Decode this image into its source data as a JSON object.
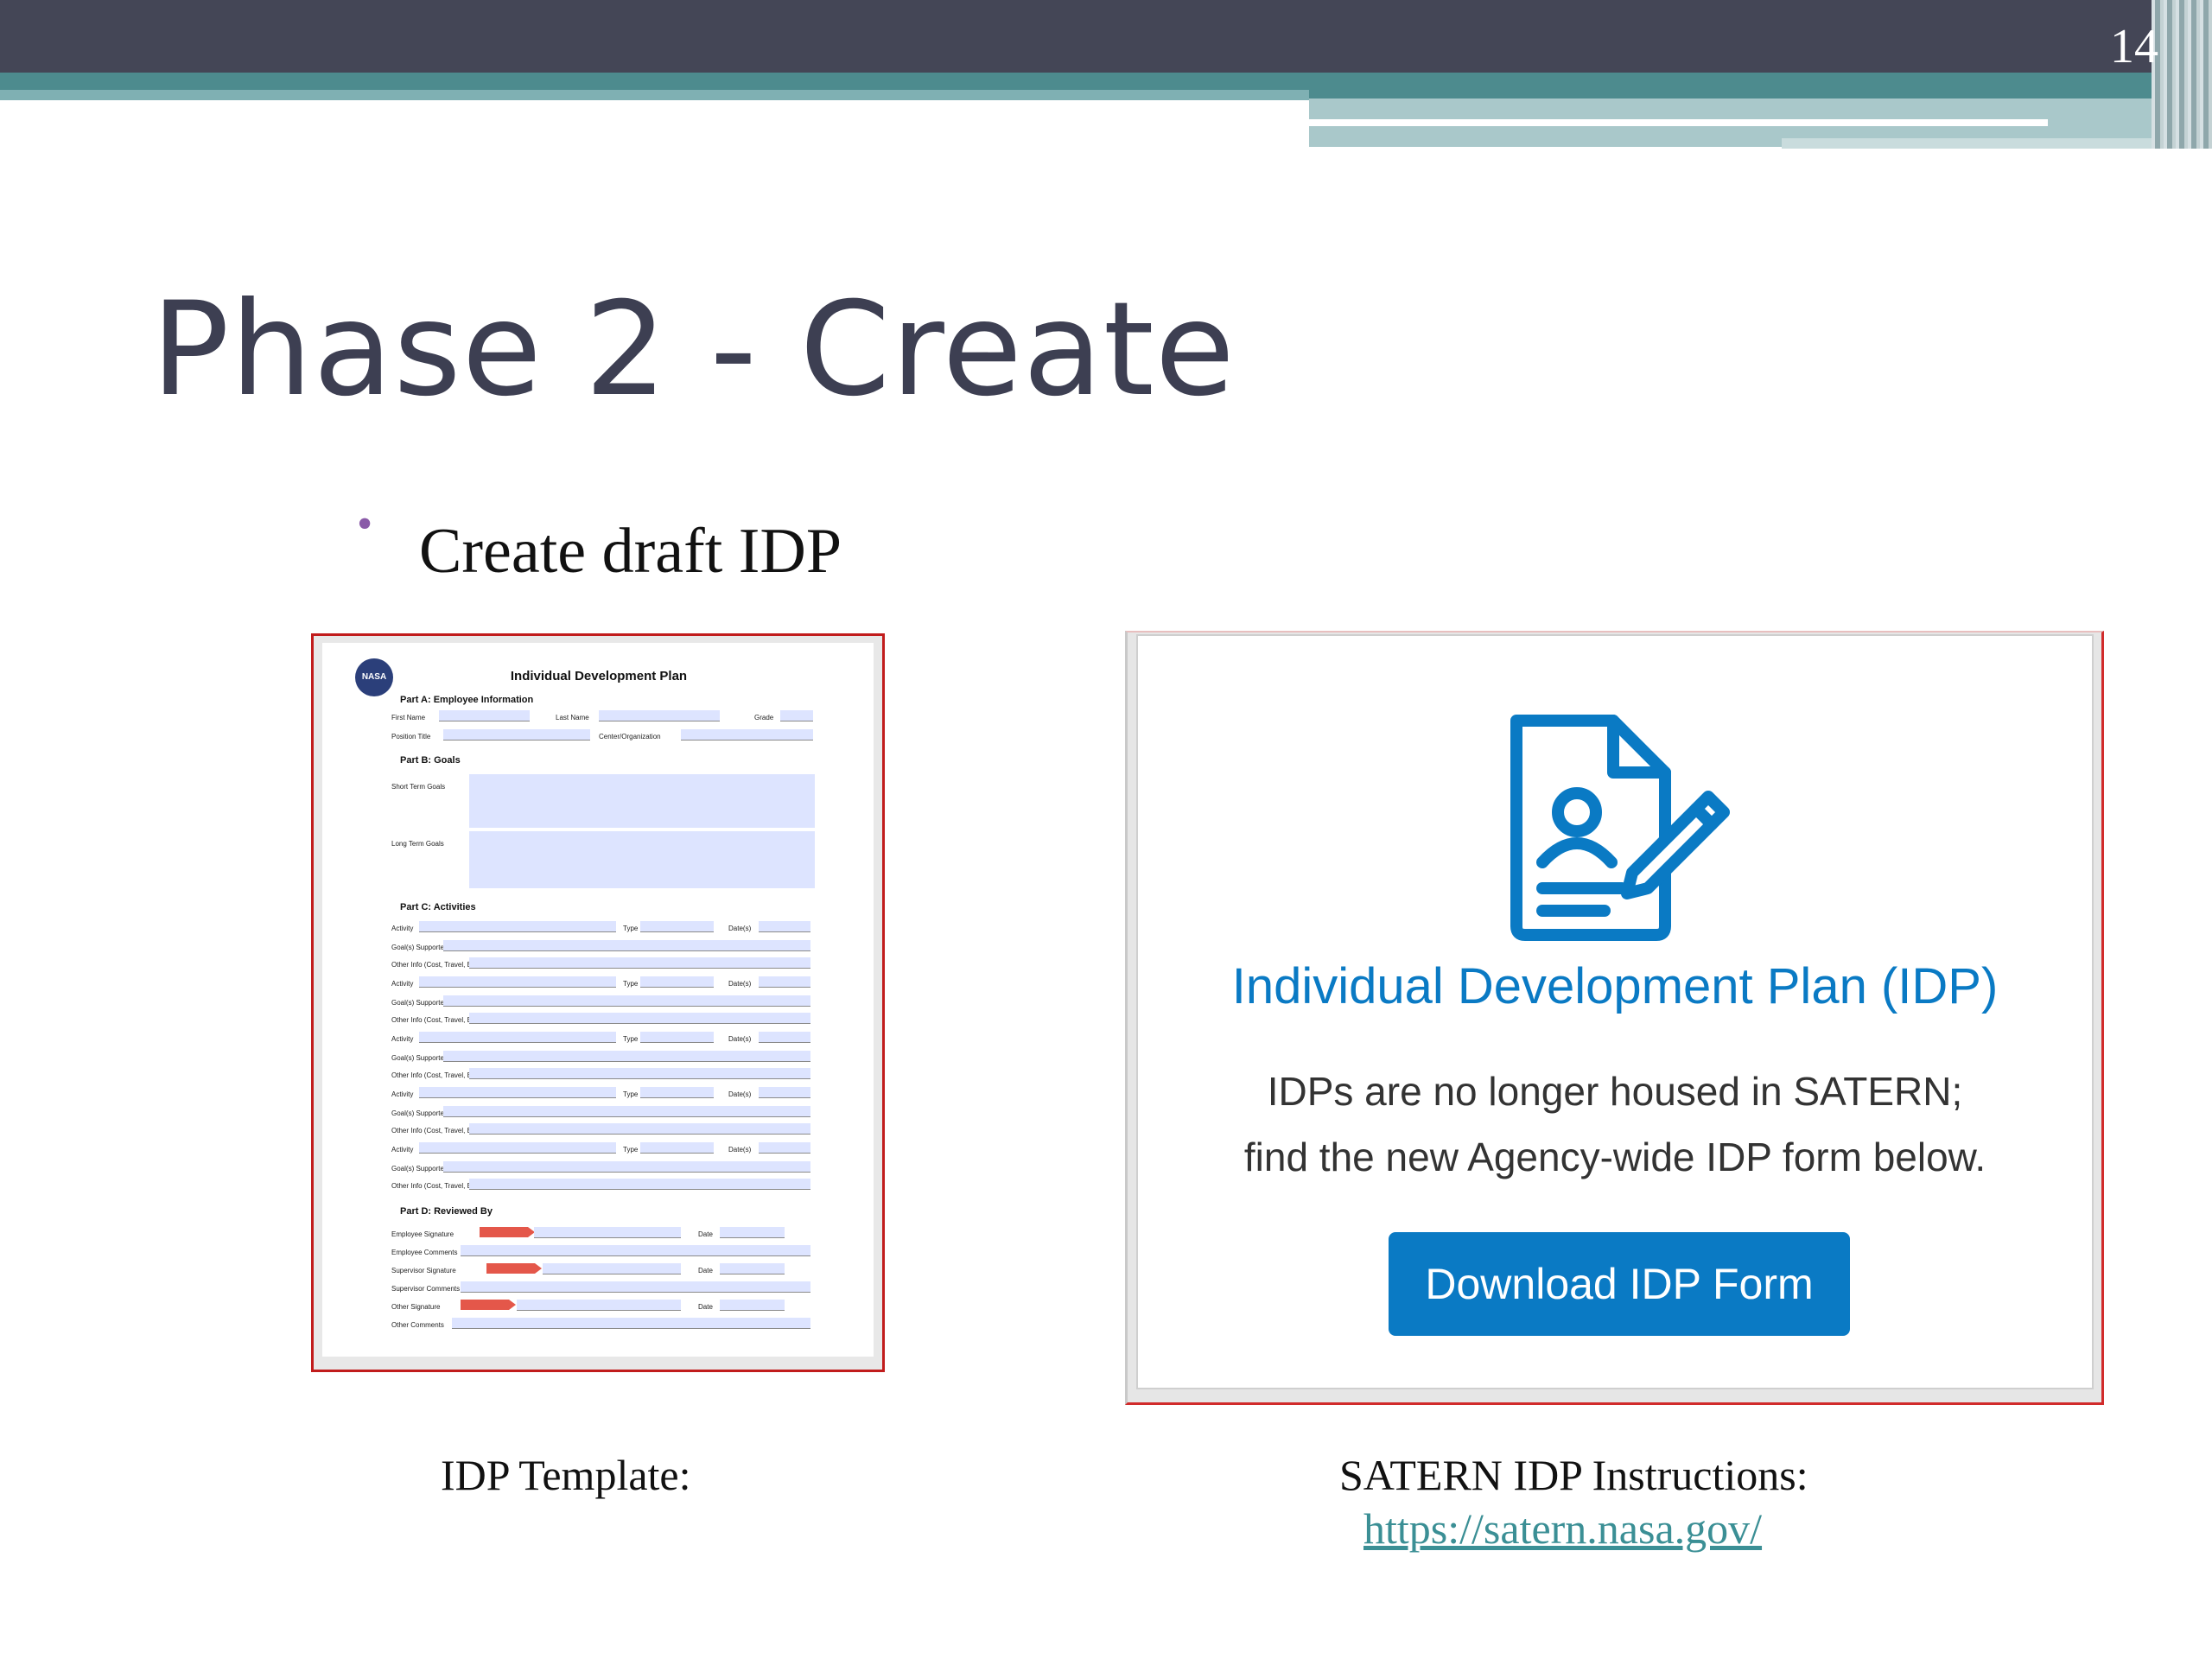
{
  "slide": {
    "page_number": "14",
    "title": "Phase 2 - Create",
    "bullet": "Create draft IDP"
  },
  "form": {
    "title": "Individual Development Plan",
    "logo_text": "NASA",
    "part_a": "Part A: Employee Information",
    "first_name": "First Name",
    "last_name": "Last Name",
    "grade": "Grade",
    "position_title": "Position Title",
    "center_org": "Center/Organization",
    "part_b": "Part B: Goals",
    "short_term": "Short Term Goals",
    "long_term": "Long Term Goals",
    "part_c": "Part C: Activities",
    "activity": "Activity",
    "type": "Type",
    "dates": "Date(s)",
    "goals_supported": "Goal(s) Supported",
    "other_info": "Other Info (Cost, Travel, Etc)",
    "part_d": "Part D: Reviewed By",
    "employee_signature": "Employee Signature",
    "employee_comments": "Employee Comments",
    "supervisor_signature": "Supervisor Signature",
    "supervisor_comments": "Supervisor Comments",
    "other_signature": "Other Signature",
    "other_comments": "Other Comments",
    "date": "Date"
  },
  "satern": {
    "heading": "Individual Development Plan (IDP)",
    "line1": "IDPs are no longer housed in SATERN;",
    "line2": "find the new Agency-wide IDP form below.",
    "button": "Download IDP Form",
    "icon": "document-user-pencil-icon",
    "accent_color": "#0a7ac4"
  },
  "captions": {
    "left": "IDP Template:",
    "right": "SATERN IDP Instructions:",
    "link": "https://satern.nasa.gov/"
  }
}
